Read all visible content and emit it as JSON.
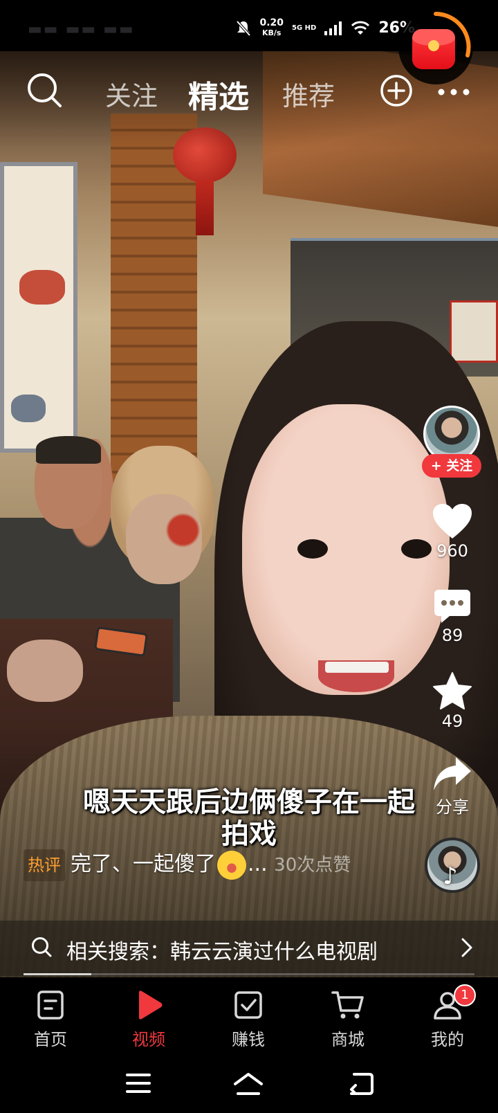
{
  "status_bar": {
    "net_speed": "0.20",
    "net_unit": "KB/s",
    "net_type": "5G HD",
    "battery": "26%"
  },
  "top_nav": {
    "tabs": [
      {
        "label": "关注",
        "active": false
      },
      {
        "label": "精选",
        "active": true
      },
      {
        "label": "推荐",
        "active": false
      }
    ],
    "icons": [
      "search-icon",
      "plus-circle-icon",
      "more-dots-icon"
    ]
  },
  "author": {
    "follow_label": "+ 关注"
  },
  "actions": {
    "likes": "960",
    "comments": "89",
    "favorites": "49",
    "share_label": "分享"
  },
  "caption": "嗯天天跟后边俩傻子在一起拍戏",
  "hot_comment": {
    "tag": "热评",
    "text": "完了、一起傻了",
    "ellipsis": "...",
    "likes": "30次点赞"
  },
  "related_search": {
    "text": "相关搜索：韩云云演过什么电视剧"
  },
  "progress": 0.15,
  "tabbar": {
    "items": [
      {
        "label": "首页",
        "icon": "home-doc-icon",
        "active": false
      },
      {
        "label": "视频",
        "icon": "play-icon",
        "active": true
      },
      {
        "label": "赚钱",
        "icon": "checkbox-icon",
        "active": false
      },
      {
        "label": "商城",
        "icon": "cart-icon",
        "active": false
      },
      {
        "label": "我的",
        "icon": "user-icon",
        "active": false,
        "badge": "1"
      }
    ]
  },
  "colors": {
    "accent": "#f0383d",
    "hot_tag": "#ff9e2e"
  }
}
